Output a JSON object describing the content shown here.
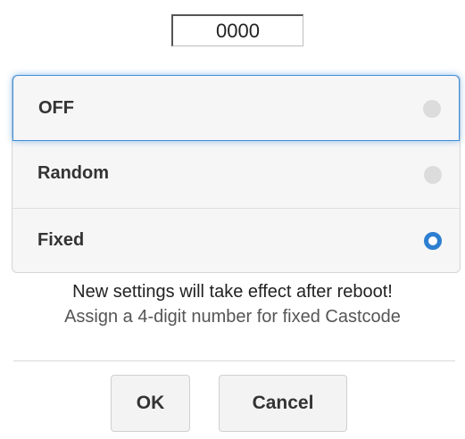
{
  "castcode": {
    "value": "0000"
  },
  "options": [
    {
      "label": "OFF",
      "selected": false,
      "focused": true
    },
    {
      "label": "Random",
      "selected": false,
      "focused": false
    },
    {
      "label": "Fixed",
      "selected": true,
      "focused": false
    }
  ],
  "messages": {
    "reboot_notice": "New settings will take effect after reboot!",
    "hint": "Assign a 4-digit number for fixed Castcode"
  },
  "buttons": {
    "ok_label": "OK",
    "cancel_label": "Cancel"
  },
  "colors": {
    "accent": "#2d7fd0",
    "focus_glow": "#3f8fd8",
    "radio_off": "#dcdcdc"
  }
}
